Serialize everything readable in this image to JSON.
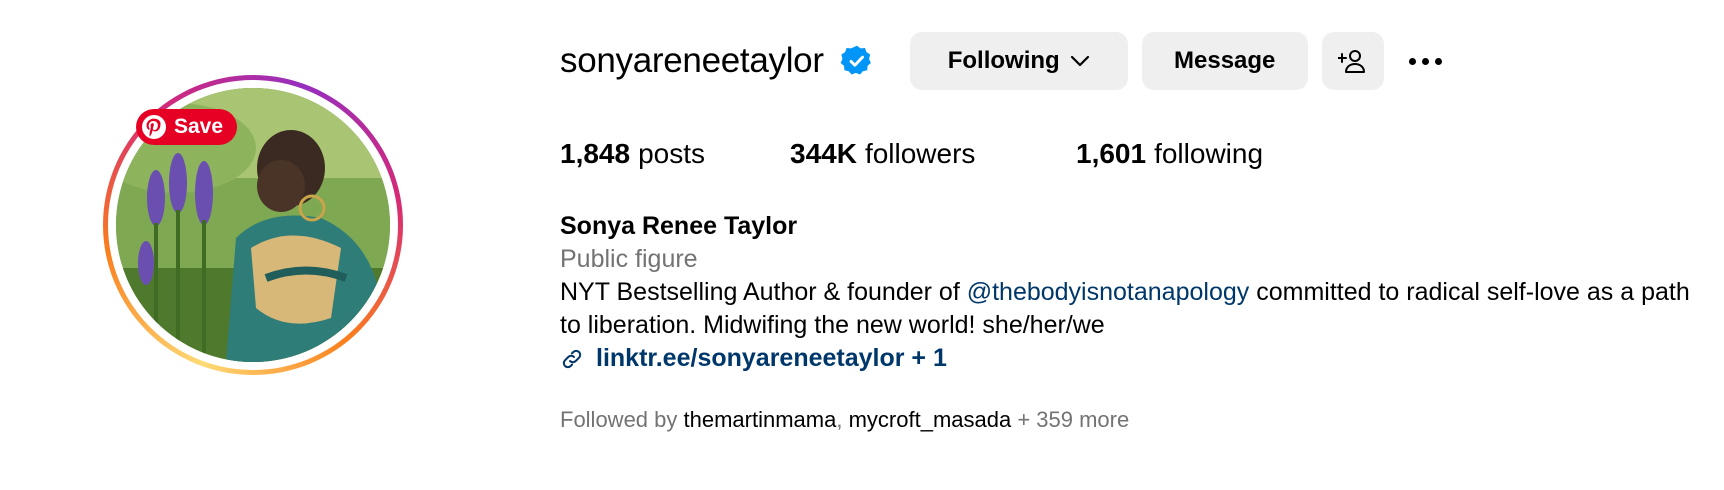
{
  "profile": {
    "username": "sonyareneetaylor",
    "full_name": "Sonya Renee Taylor",
    "category": "Public figure",
    "bio_prefix": "NYT Bestselling Author & founder of ",
    "bio_mention": "@thebodyisnotanapology",
    "bio_suffix": " committed to radical self-love as a path to liberation. Midwifing the new world! she/her/we",
    "link": "linktr.ee/sonyareneetaylor + 1"
  },
  "pin_save": {
    "label": "Save"
  },
  "actions": {
    "following_label": "Following",
    "message_label": "Message"
  },
  "stats": {
    "posts_count": "1,848",
    "posts_label": "posts",
    "followers_count": "344K",
    "followers_label": "followers",
    "following_count": "1,601",
    "following_label": "following"
  },
  "followed_by": {
    "prefix": "Followed by ",
    "users": [
      "themartinmama",
      "mycroft_masada"
    ],
    "separator": ", ",
    "more": " + 359 more"
  },
  "colors": {
    "verified": "#0095f6",
    "link": "#00376b",
    "secondary_text": "#737373",
    "button_bg": "#efefef",
    "pinterest": "#e60023"
  },
  "icons": [
    "verified-badge-icon",
    "chevron-down-icon",
    "add-person-icon",
    "more-options-icon",
    "link-icon",
    "pinterest-icon"
  ]
}
